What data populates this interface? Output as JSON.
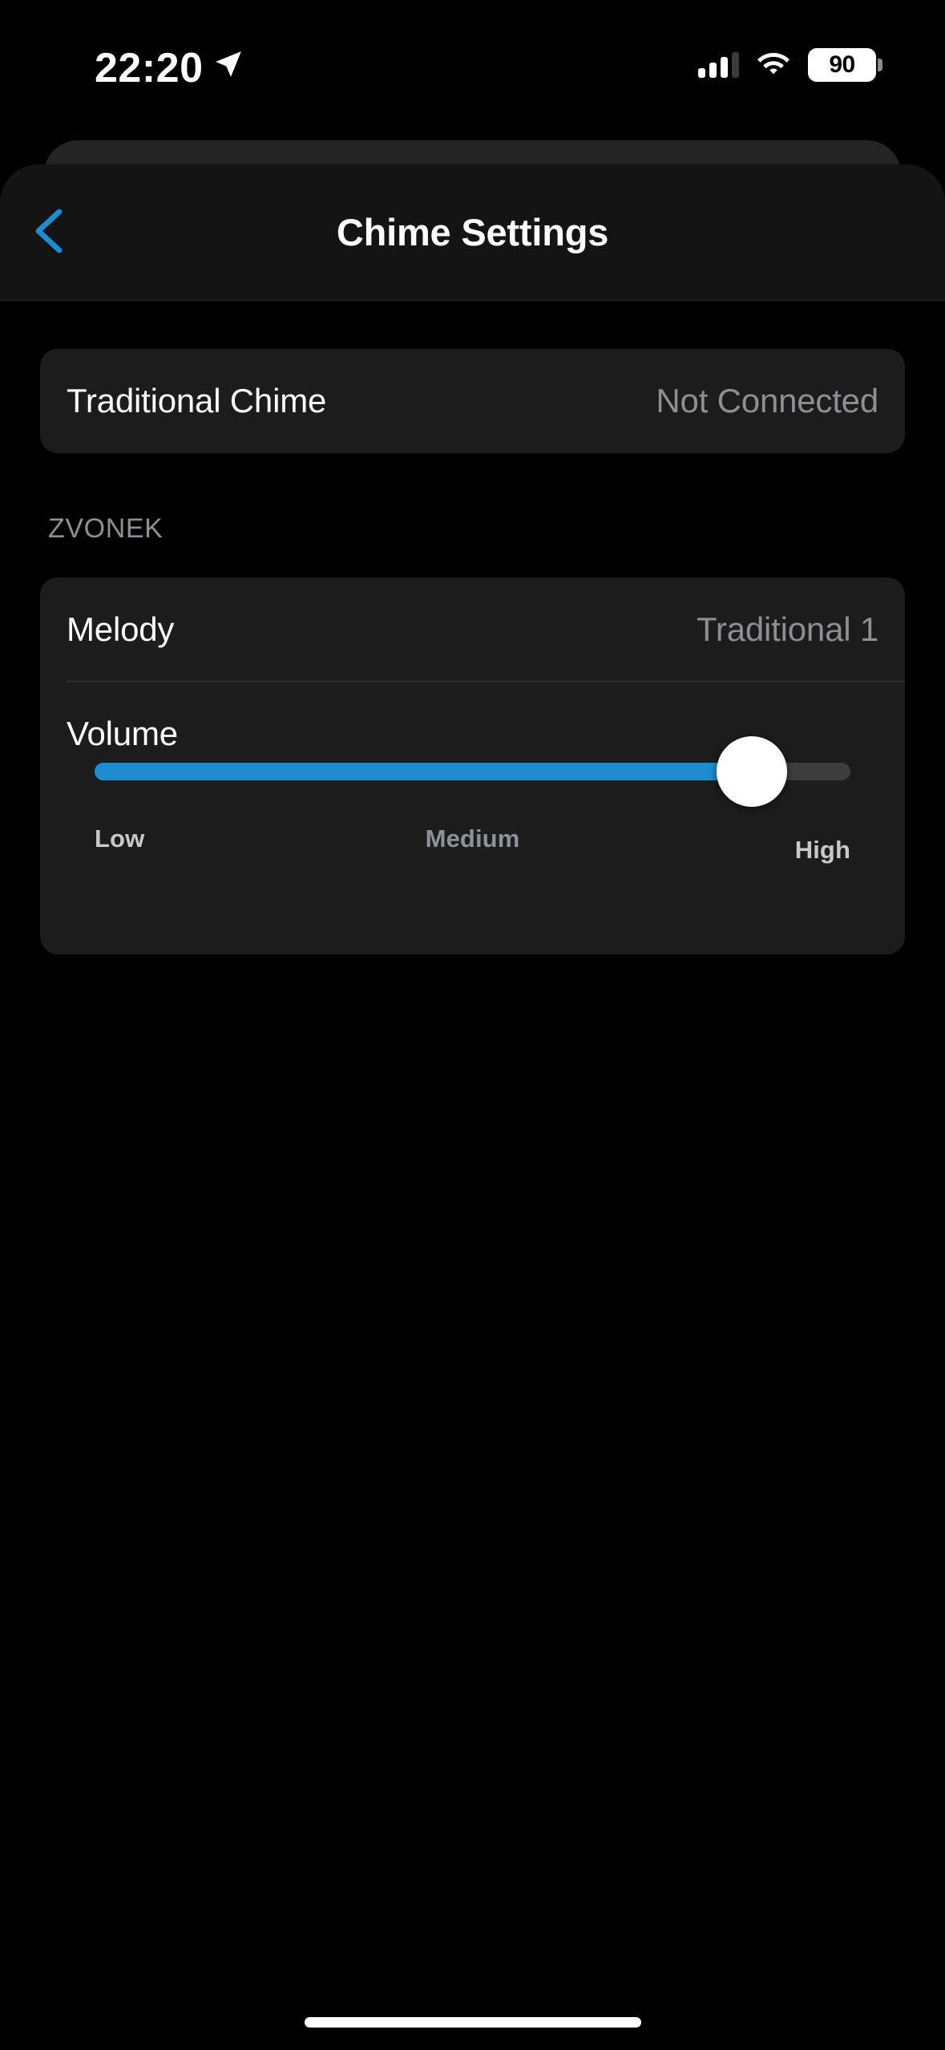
{
  "status_bar": {
    "time": "22:20",
    "location_icon": "location-arrow-icon",
    "cellular_icon": "cellular-signal-icon",
    "cellular_bars_filled": 3,
    "cellular_bars_total": 4,
    "wifi_icon": "wifi-icon",
    "battery_icon": "battery-icon",
    "battery_percent": "90"
  },
  "nav": {
    "back_icon": "chevron-left-icon",
    "title": "Chime Settings"
  },
  "status_card": {
    "label": "Traditional Chime",
    "value": "Not Connected"
  },
  "section": {
    "header": "ZVONEK"
  },
  "chime": {
    "melody": {
      "label": "Melody",
      "value": "Traditional 1"
    },
    "volume": {
      "label": "Volume",
      "percent": 87,
      "scale_low": "Low",
      "scale_medium": "Medium",
      "scale_high": "High"
    }
  },
  "colors": {
    "accent": "#1b8dd0",
    "background": "#000000",
    "card": "#1c1c1c",
    "navbar": "#141414",
    "secondary_text": "#8e8e93",
    "track_empty": "#3d3d3d"
  },
  "home_indicator": "home-indicator"
}
